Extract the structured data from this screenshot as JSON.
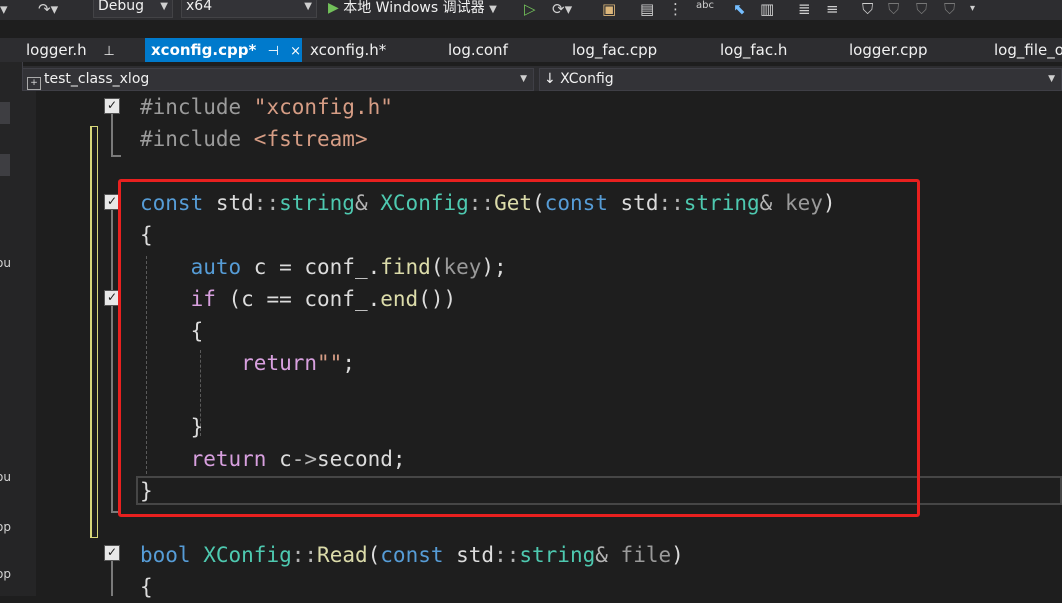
{
  "toolbar": {
    "config": "Debug",
    "platform": "x64",
    "run_label": "本地 Windows 调试器"
  },
  "tabs": [
    {
      "label": "logger.h",
      "pin": "📌"
    },
    {
      "label": "xconfig.cpp*",
      "pin": "⊣",
      "close": "×"
    },
    {
      "label": "xconfig.h*"
    },
    {
      "label": "log.conf"
    },
    {
      "label": "log_fac.cpp"
    },
    {
      "label": "log_fac.h"
    },
    {
      "label": "logger.cpp"
    },
    {
      "label": "log_file_o"
    }
  ],
  "nav": {
    "project": "test_class_xlog",
    "scope": "↓ XConfig"
  },
  "left_panel_text": [
    "ou",
    "ou",
    "op",
    "op"
  ],
  "code_lines": [
    "#include \"xconfig.h\"",
    "#include <fstream>",
    "",
    "const std::string& XConfig::Get(const std::string& key)",
    "{",
    "    auto c = conf_.find(key);",
    "    if (c == conf_.end())",
    "    {",
    "        return\"\";",
    "",
    "    }",
    "    return c->second;",
    "}",
    "",
    "bool XConfig::Read(const std::string& file)",
    "{"
  ],
  "colors": {
    "keyword": "#569cd6",
    "control": "#d8a0df",
    "string": "#d69d85",
    "type": "#4ec9b0",
    "function": "#dcdcaa",
    "highlight": "#e8201f",
    "active_tab": "#007acc"
  }
}
